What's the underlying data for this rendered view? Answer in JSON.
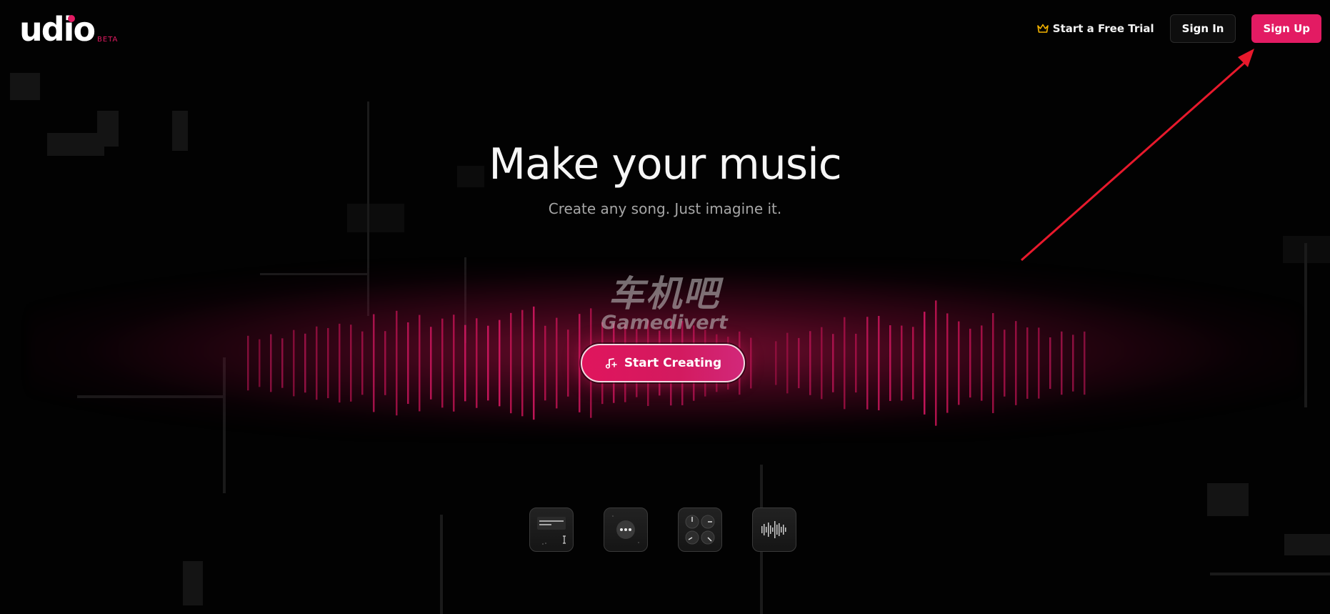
{
  "brand": {
    "name": "udio",
    "badge": "BETA",
    "accent_color": "#e31b63"
  },
  "nav": {
    "trial_label": "Start a Free Trial",
    "trial_icon": "crown-icon",
    "signin_label": "Sign In",
    "signup_label": "Sign Up"
  },
  "hero": {
    "title": "Make your music",
    "subtitle": "Create any song. Just imagine it.",
    "cta_label": "Start Creating",
    "cta_icon": "music-note-plus-icon"
  },
  "watermark": {
    "line1": "车机吧",
    "line2": "Gamedivert"
  },
  "features": [
    {
      "icon": "text-prompt-icon"
    },
    {
      "icon": "chat-bubble-icon"
    },
    {
      "icon": "knobs-icon"
    },
    {
      "icon": "waveform-icon"
    }
  ]
}
